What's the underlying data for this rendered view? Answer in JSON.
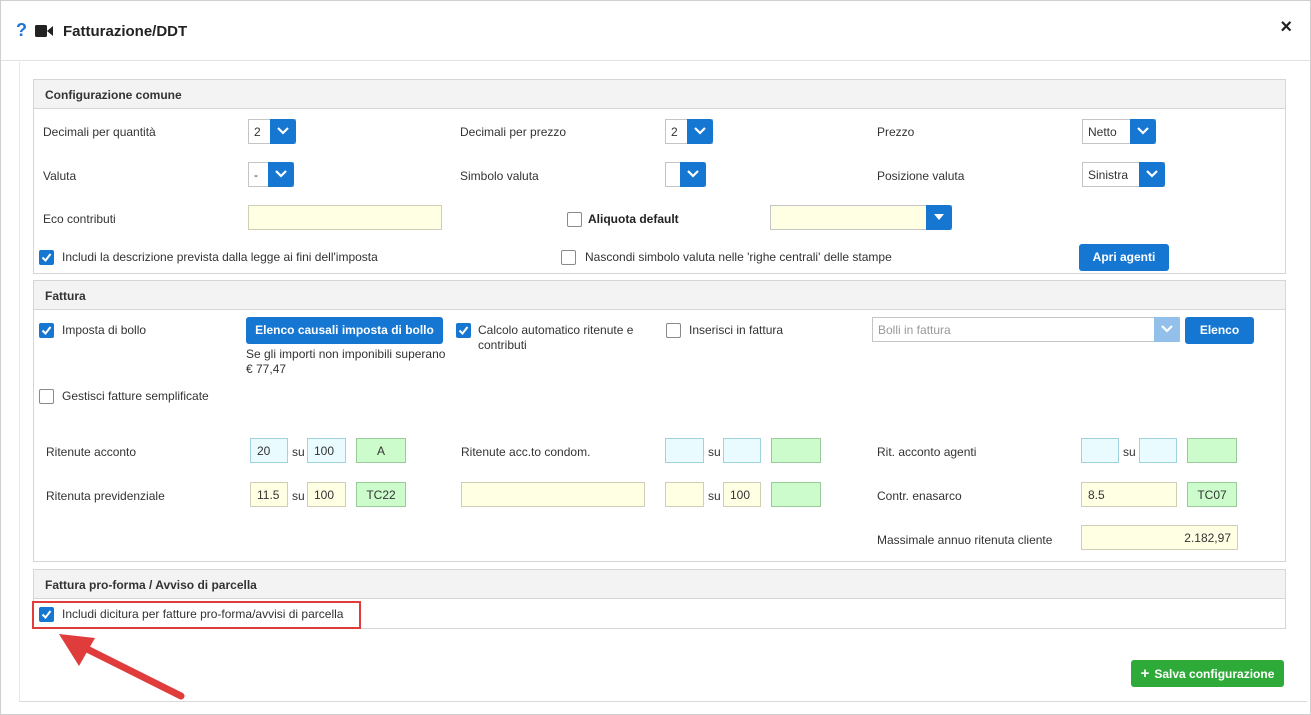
{
  "header": {
    "title": "Fatturazione/DDT",
    "help_icon": "help-icon",
    "video_icon": "video-camera-icon",
    "close_label": "×"
  },
  "config": {
    "title": "Configurazione comune",
    "decimali_quantita_label": "Decimali per quantità",
    "decimali_quantita_value": "2",
    "decimali_prezzo_label": "Decimali per prezzo",
    "decimali_prezzo_value": "2",
    "prezzo_label": "Prezzo",
    "prezzo_value": "Netto",
    "valuta_label": "Valuta",
    "valuta_value": "-",
    "simbolo_valuta_label": "Simbolo valuta",
    "simbolo_valuta_value": "",
    "posizione_valuta_label": "Posizione valuta",
    "posizione_valuta_value": "Sinistra",
    "eco_contributi_label": "Eco contributi",
    "eco_contributi_value": "",
    "aliquota_default_label": "Aliquota default",
    "aliquota_default_checked": false,
    "aliquota_default_value": "",
    "includi_descrizione_label": "Includi la descrizione prevista dalla legge ai fini dell'imposta",
    "includi_descrizione_checked": true,
    "nascondi_simbolo_label": "Nascondi simbolo valuta nelle 'righe centrali' delle stampe",
    "nascondi_simbolo_checked": false,
    "apri_agenti_label": "Apri agenti"
  },
  "fattura": {
    "title": "Fattura",
    "imposta_bollo_label": "Imposta di bollo",
    "imposta_bollo_checked": true,
    "elenco_causali_label": "Elenco causali imposta di bollo",
    "bollo_note_line1": "Se gli importi non imponibili superano",
    "bollo_note_line2": "€ 77,47",
    "calcolo_auto_line1": "Calcolo automatico ritenute e",
    "calcolo_auto_line2": "contributi",
    "calcolo_auto_checked": true,
    "inserisci_fattura_label": "Inserisci in fattura",
    "inserisci_fattura_checked": false,
    "bolli_placeholder": "Bolli in fattura",
    "elenco_label": "Elenco",
    "gestisci_semplificate_label": "Gestisci fatture semplificate",
    "gestisci_semplificate_checked": false,
    "su_label": "su",
    "ritenute_acconto_label": "Ritenute acconto",
    "ritenute_acconto_perc": "20",
    "ritenute_acconto_base": "100",
    "ritenute_acconto_code": "A",
    "ritenute_condom_label": "Ritenute acc.to condom.",
    "ritenute_condom_perc": "",
    "ritenute_condom_base": "",
    "ritenute_condom_code": "",
    "rit_agenti_label": "Rit. acconto agenti",
    "rit_agenti_perc": "",
    "rit_agenti_base": "",
    "rit_agenti_code": "",
    "ritenuta_prev_label": "Ritenuta previdenziale",
    "ritenuta_prev_perc": "11.5",
    "ritenuta_prev_base": "100",
    "ritenuta_prev_code": "TC22",
    "ritenuta_prev2_desc": "",
    "ritenuta_prev2_perc": "",
    "ritenuta_prev2_base": "100",
    "ritenuta_prev2_code": "",
    "enasarco_label": "Contr. enasarco",
    "enasarco_value": "8.5",
    "enasarco_code": "TC07",
    "massimale_label": "Massimale annuo ritenuta cliente",
    "massimale_value": "2.182,97"
  },
  "proforma": {
    "title": "Fattura pro-forma / Avviso di parcella",
    "includi_dicitura_label": "Includi dicitura per fatture pro-forma/avvisi di parcella",
    "includi_dicitura_checked": true
  },
  "footer": {
    "salva_label": "Salva configurazione"
  },
  "colors": {
    "accent": "#1677d2",
    "success": "#2eaa39",
    "highlight": "#e03c3c"
  }
}
